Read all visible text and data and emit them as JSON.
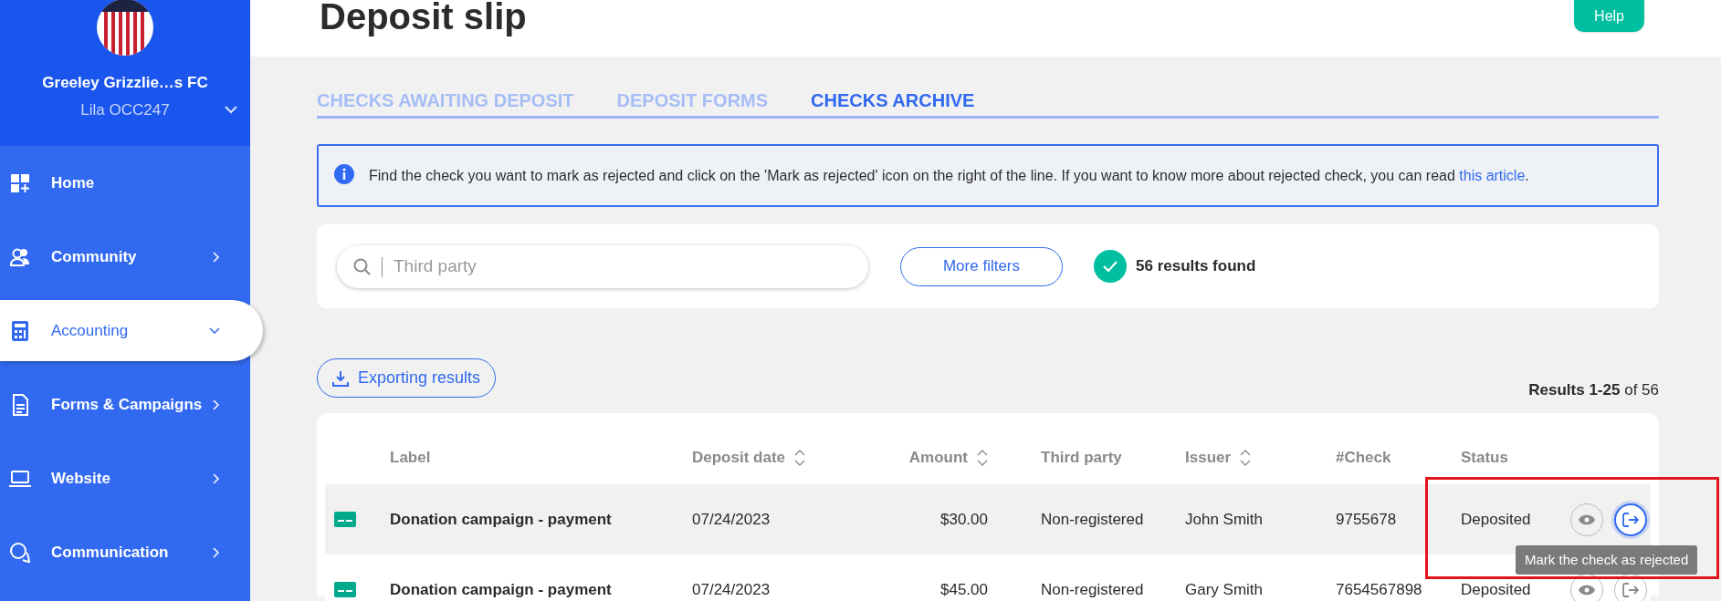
{
  "sidebar": {
    "club_name": "Greeley Grizzlie…s FC",
    "user": "Lila OCC247",
    "items": [
      {
        "label": "Home",
        "kind": "home",
        "expanded": false,
        "selected": false
      },
      {
        "label": "Community",
        "kind": "community",
        "expanded": false,
        "selected": false
      },
      {
        "label": "Accounting",
        "kind": "accounting",
        "expanded": true,
        "selected": true
      },
      {
        "label": "Forms & Campaigns",
        "kind": "forms",
        "expanded": false,
        "selected": false
      },
      {
        "label": "Website",
        "kind": "website",
        "expanded": false,
        "selected": false
      },
      {
        "label": "Communication",
        "kind": "communication",
        "expanded": false,
        "selected": false
      }
    ]
  },
  "header": {
    "title": "Deposit slip",
    "help_button": "Help"
  },
  "tabs": [
    {
      "label": "CHECKS AWAITING DEPOSIT",
      "selected": false
    },
    {
      "label": "DEPOSIT FORMS",
      "selected": false
    },
    {
      "label": "CHECKS ARCHIVE",
      "selected": true
    }
  ],
  "info": {
    "text": "Find the check you want to mark as rejected and click on the 'Mark as rejected' icon on the right of the line. If you want to know more about rejected check, you can read",
    "link": "this article",
    "after": "."
  },
  "search": {
    "placeholder": "Third party",
    "filters_button": "More filters",
    "results_found": "56 results found"
  },
  "export_button": "Exporting results",
  "results_range": "**Results 1-25** of 56",
  "table": {
    "columns": [
      {
        "label": "Label",
        "sortable": false
      },
      {
        "label": "Deposit date",
        "sortable": true
      },
      {
        "label": "Amount",
        "sortable": true
      },
      {
        "label": "Third party",
        "sortable": false
      },
      {
        "label": "Issuer",
        "sortable": true
      },
      {
        "label": "#Check",
        "sortable": false
      },
      {
        "label": "Status",
        "sortable": false
      }
    ],
    "rows": [
      {
        "cells": [
          "Donation campaign - payment",
          "07/24/2023",
          "$30.00",
          "Non-registered",
          "John Smith",
          "9755678",
          "Deposited"
        ],
        "selected": true,
        "reject_hovered": true
      },
      {
        "cells": [
          "Donation campaign - payment",
          "07/24/2023",
          "$45.00",
          "Non-registered",
          "Gary Smith",
          "7654567898",
          "Deposited"
        ],
        "selected": false,
        "reject_hovered": false
      }
    ]
  },
  "tooltip": "Mark the check as rejected"
}
